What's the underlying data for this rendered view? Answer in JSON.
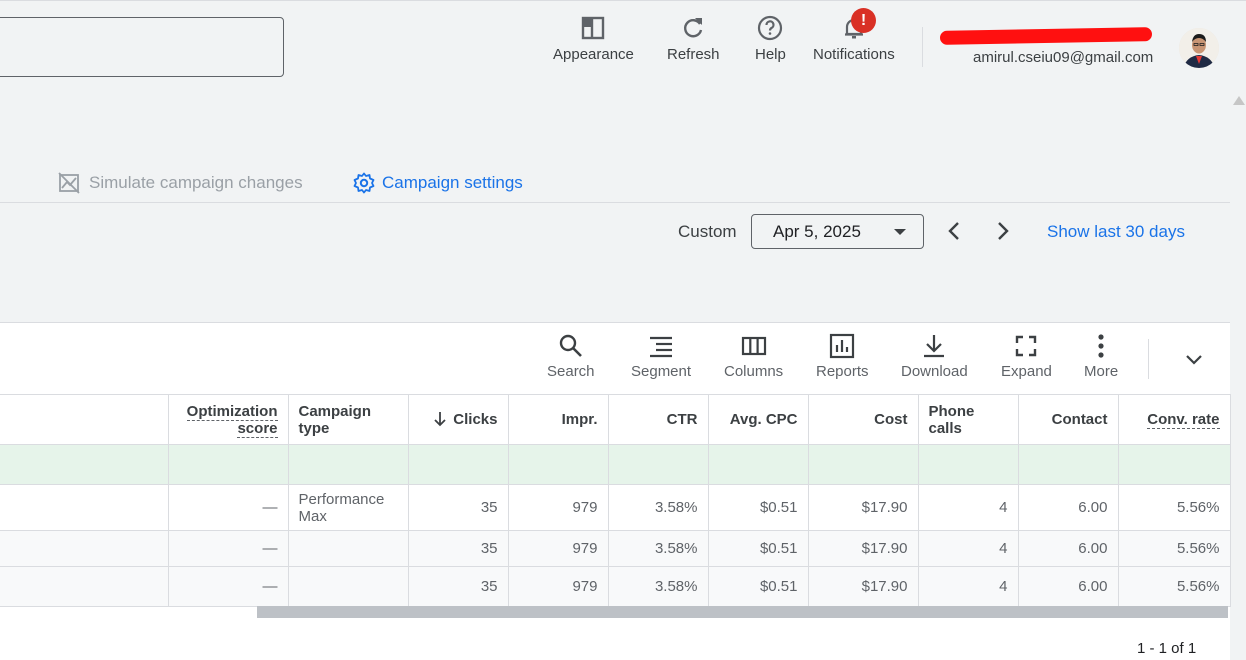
{
  "header": {
    "tools": [
      {
        "label": "Appearance",
        "icon": "appearance-icon"
      },
      {
        "label": "Refresh",
        "icon": "refresh-icon"
      },
      {
        "label": "Help",
        "icon": "help-icon"
      },
      {
        "label": "Notifications",
        "icon": "bell-icon",
        "badge": "!"
      }
    ],
    "account_email": "amirul.cseiu09@gmail.com"
  },
  "actions": {
    "simulate_label": "Simulate campaign changes",
    "campaign_settings_label": "Campaign settings"
  },
  "date_range": {
    "mode_label": "Custom",
    "selected": "Apr 5, 2025",
    "show_last_label": "Show last 30 days"
  },
  "table_toolbar": {
    "buttons": [
      {
        "label": "Search",
        "icon": "search-icon"
      },
      {
        "label": "Segment",
        "icon": "segment-icon"
      },
      {
        "label": "Columns",
        "icon": "columns-icon"
      },
      {
        "label": "Reports",
        "icon": "reports-icon"
      },
      {
        "label": "Download",
        "icon": "download-icon"
      },
      {
        "label": "Expand",
        "icon": "expand-icon"
      },
      {
        "label": "More",
        "icon": "more-vert-icon"
      }
    ]
  },
  "table": {
    "columns": [
      "",
      "Optimization score",
      "Campaign type",
      "Clicks",
      "Impr.",
      "CTR",
      "Avg. CPC",
      "Cost",
      "Phone calls",
      "Contact",
      "Conv. rate"
    ],
    "col_opt_1": "Optimization",
    "col_opt_2": "score",
    "col_type_1": "Campaign",
    "col_type_2": "type",
    "rows": [
      {
        "opt": "—",
        "type": "Performance Max",
        "clicks": "35",
        "impr": "979",
        "ctr": "3.58%",
        "cpc": "$0.51",
        "cost": "$17.90",
        "calls": "4",
        "contact": "6.00",
        "conv": "5.56%"
      },
      {
        "opt": "—",
        "type": "",
        "clicks": "35",
        "impr": "979",
        "ctr": "3.58%",
        "cpc": "$0.51",
        "cost": "$17.90",
        "calls": "4",
        "contact": "6.00",
        "conv": "5.56%"
      },
      {
        "opt": "—",
        "type": "",
        "clicks": "35",
        "impr": "979",
        "ctr": "3.58%",
        "cpc": "$0.51",
        "cost": "$17.90",
        "calls": "4",
        "contact": "6.00",
        "conv": "5.56%"
      }
    ],
    "pagination": "1 - 1 of 1"
  },
  "colors": {
    "accent": "#1a73e8",
    "badge": "#d93025",
    "total_row": "#e6f4ea"
  }
}
